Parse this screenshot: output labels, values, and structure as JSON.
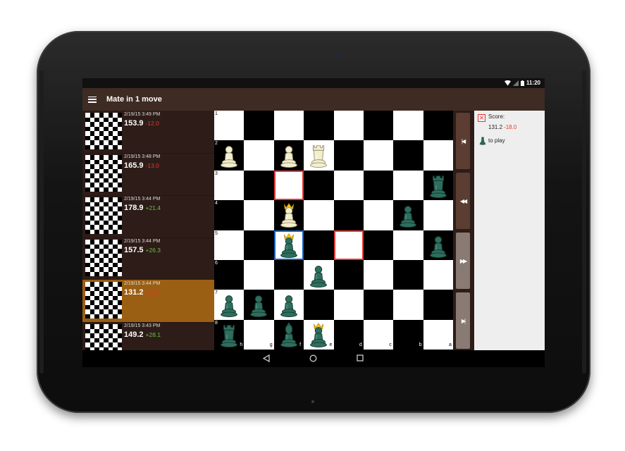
{
  "status_bar": {
    "time": "11:20"
  },
  "app_bar": {
    "title": "Mate in 1 move"
  },
  "history": [
    {
      "date": "2/19/15 3:49 PM",
      "score": "153.9",
      "delta": "-12.0",
      "delta_type": "neg",
      "selected": false
    },
    {
      "date": "2/19/15 3:48 PM",
      "score": "165.9",
      "delta": "-13.0",
      "delta_type": "neg",
      "selected": false
    },
    {
      "date": "2/19/15 3:44 PM",
      "score": "178.9",
      "delta": "+21.4",
      "delta_type": "pos",
      "selected": false
    },
    {
      "date": "2/19/15 3:44 PM",
      "score": "157.5",
      "delta": "+26.3",
      "delta_type": "pos",
      "selected": false
    },
    {
      "date": "2/19/15 3:44 PM",
      "score": "131.2",
      "delta": "-18.0",
      "delta_type": "neg",
      "selected": true
    },
    {
      "date": "2/19/15 3:43 PM",
      "score": "149.2",
      "delta": "+28.1",
      "delta_type": "pos",
      "selected": false
    }
  ],
  "board": {
    "rank_labels": [
      "1",
      "2",
      "3",
      "4",
      "5",
      "6",
      "7",
      "8"
    ],
    "file_labels": [
      "h",
      "g",
      "f",
      "e",
      "d",
      "c",
      "b",
      "a"
    ],
    "highlights": [
      {
        "row": 2,
        "col": 2,
        "color": "red"
      },
      {
        "row": 4,
        "col": 2,
        "color": "blue"
      },
      {
        "row": 4,
        "col": 4,
        "color": "red"
      }
    ],
    "pieces": [
      {
        "row": 1,
        "col": 0,
        "type": "pawn",
        "side": "white"
      },
      {
        "row": 1,
        "col": 2,
        "type": "pawn",
        "side": "white"
      },
      {
        "row": 1,
        "col": 3,
        "type": "rook",
        "side": "white"
      },
      {
        "row": 2,
        "col": 7,
        "type": "rook",
        "side": "green"
      },
      {
        "row": 3,
        "col": 2,
        "type": "king",
        "side": "white"
      },
      {
        "row": 3,
        "col": 6,
        "type": "pawn",
        "side": "green"
      },
      {
        "row": 4,
        "col": 2,
        "type": "king",
        "side": "green"
      },
      {
        "row": 4,
        "col": 7,
        "type": "pawn",
        "side": "green"
      },
      {
        "row": 5,
        "col": 3,
        "type": "pawn",
        "side": "green"
      },
      {
        "row": 6,
        "col": 0,
        "type": "pawn",
        "side": "green"
      },
      {
        "row": 6,
        "col": 1,
        "type": "pawn",
        "side": "green"
      },
      {
        "row": 6,
        "col": 2,
        "type": "pawn",
        "side": "green"
      },
      {
        "row": 7,
        "col": 0,
        "type": "rook",
        "side": "green"
      },
      {
        "row": 7,
        "col": 2,
        "type": "bishop",
        "side": "green"
      },
      {
        "row": 7,
        "col": 3,
        "type": "queen",
        "side": "green"
      }
    ]
  },
  "nav_buttons": [
    {
      "name": "first-move-button",
      "icon": "skip-to-start-icon",
      "glyph": "|◀",
      "enabled": true
    },
    {
      "name": "previous-move-button",
      "icon": "rewind-icon",
      "glyph": "◀◀",
      "enabled": true
    },
    {
      "name": "next-move-button",
      "icon": "fast-forward-icon",
      "glyph": "▶▶",
      "enabled": false
    },
    {
      "name": "last-move-button",
      "icon": "skip-to-end-icon",
      "glyph": "▶|",
      "enabled": false
    }
  ],
  "info": {
    "score_label": "Score:",
    "score_value": "131.2",
    "score_delta": "-18.0",
    "to_play": "to play"
  },
  "colors": {
    "app_bar": "#3e2b24",
    "history_bg": "#2d1c18",
    "selected_item": "#9a5f12",
    "negative": "#e53935",
    "positive": "#6abf4b",
    "green_piece": "#2e6e5e",
    "white_piece": "#f2efd0",
    "crown": "#f5c518"
  }
}
